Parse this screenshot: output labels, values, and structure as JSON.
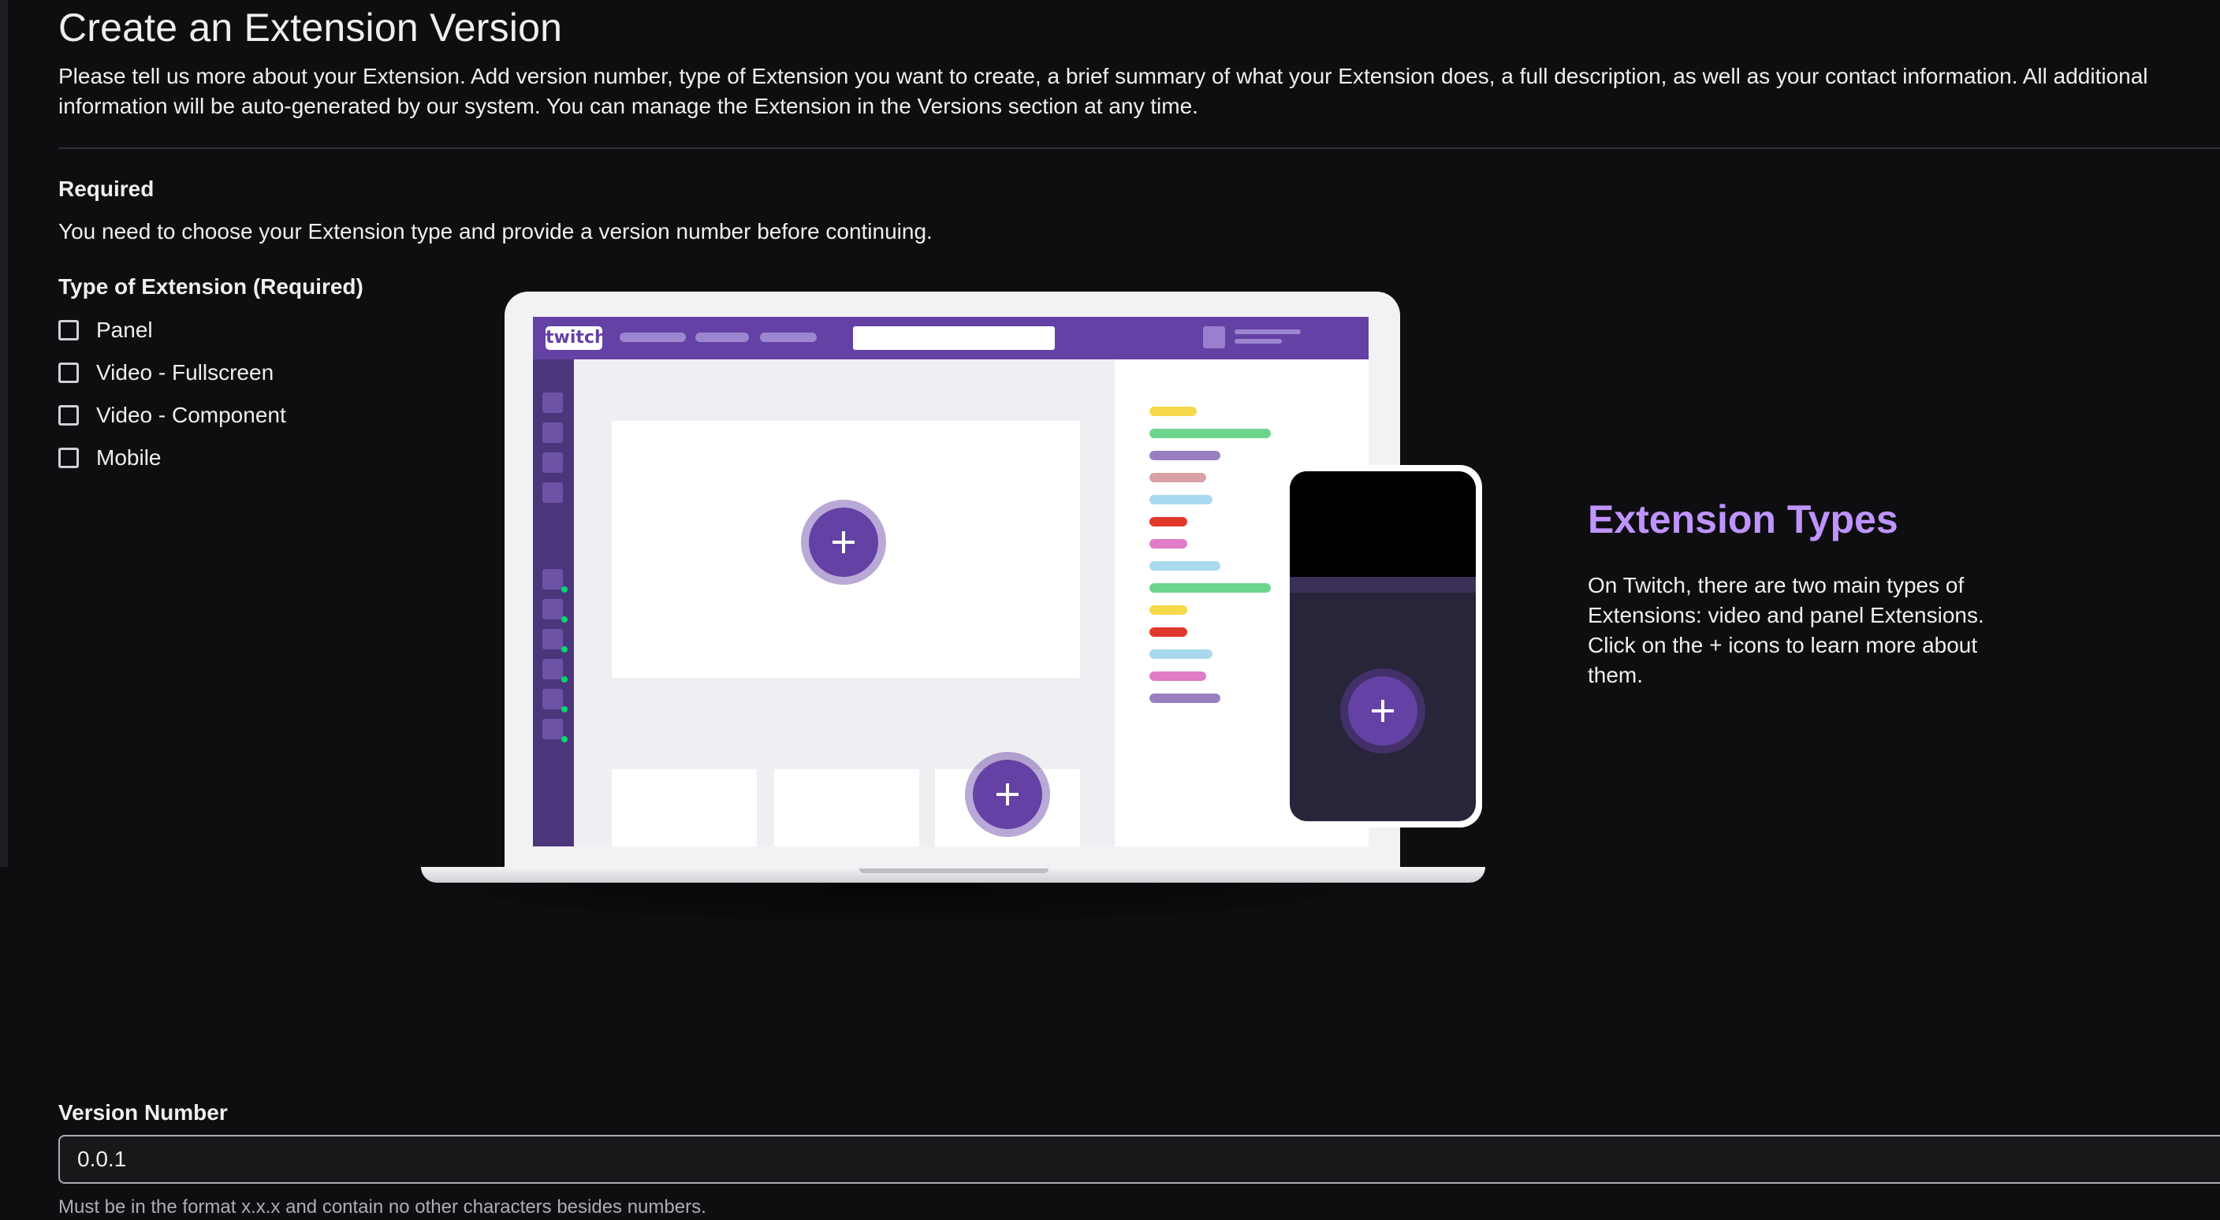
{
  "page": {
    "title": "Create an Extension Version",
    "intro": "Please tell us more about your Extension. Add version number, type of Extension you want to create, a brief summary of what your Extension does, a full description, as well as your contact information. All additional information will be auto-generated by our system. You can manage the Extension in the Versions section at any time."
  },
  "required": {
    "title": "Required",
    "description": "You need to choose your Extension type and provide a version number before continuing."
  },
  "extension_type": {
    "label": "Type of Extension (Required)",
    "options": [
      {
        "label": "Panel",
        "checked": false
      },
      {
        "label": "Video - Fullscreen",
        "checked": false
      },
      {
        "label": "Video - Component",
        "checked": false
      },
      {
        "label": "Mobile",
        "checked": false
      }
    ]
  },
  "illustration": {
    "logo_text": "twitch",
    "icons": [
      "plus-icon",
      "plus-icon",
      "plus-icon"
    ]
  },
  "extension_types_info": {
    "title": "Extension Types",
    "description": "On Twitch, there are two main types of Extensions: video and panel Extensions. Click on the + icons to learn more about them."
  },
  "version": {
    "label": "Version Number",
    "value": "0.0.1",
    "help": "Must be in the format x.x.x and contain no other characters besides numbers."
  },
  "colors": {
    "background": "#0e0e10",
    "accent": "#bf94ff",
    "brand": "#6441a5"
  }
}
